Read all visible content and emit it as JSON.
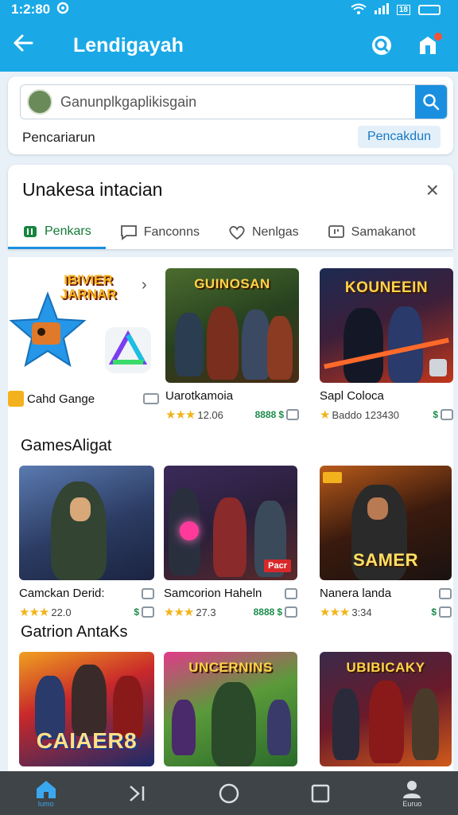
{
  "status_bar": {
    "time": "1:2:80",
    "battery": "18"
  },
  "app_bar": {
    "title": "Lendigayah",
    "back_icon": "arrow-left-icon",
    "search_icon": "search-icon",
    "notify_icon": "store-icon"
  },
  "search": {
    "value": "Ganunplkgaplikisgain",
    "label": "Pencariarun",
    "chip": "Pencakdun"
  },
  "tab_panel": {
    "heading": "Unakesa intacian",
    "tabs": [
      {
        "label": "Penkars",
        "icon": "controller-icon",
        "active": true
      },
      {
        "label": "Fanconns",
        "icon": "chat-icon",
        "active": false
      },
      {
        "label": "Nenlgas",
        "icon": "heart-icon",
        "active": false
      },
      {
        "label": "Samakanot",
        "icon": "message-icon",
        "active": false
      }
    ]
  },
  "row1": {
    "promo": {
      "logo_text": "IBIVIER JARNAR",
      "name": "Cahd Gange"
    },
    "tiles": [
      {
        "title": "GUINOSAN",
        "name": "Uarotkamoia",
        "rating": "12.06",
        "price": "8888"
      },
      {
        "title": "KOUNEEIN",
        "name": "Sapl Coloca",
        "rating": "Baddo 123430",
        "price": ""
      }
    ]
  },
  "section2": {
    "title": "GamesAligat",
    "tiles": [
      {
        "title": "",
        "name": "Camckan Derid:",
        "rating": "22.0",
        "price": ""
      },
      {
        "title": "",
        "name": "Samcorion Haheln",
        "rating": "27.3",
        "price": "8888",
        "badge": "Pacr"
      },
      {
        "title": "SAMER",
        "name": "Nanera landa",
        "rating": "3:34",
        "price": ""
      }
    ]
  },
  "section3": {
    "title": "Gatrion AntaKs",
    "tiles": [
      {
        "title": "CAIAER8"
      },
      {
        "title": "UNCERNINS"
      },
      {
        "title": "UBIBICAKY"
      }
    ]
  },
  "bottom_nav": [
    {
      "label": "Iumo",
      "icon": "home-icon",
      "active": true
    },
    {
      "label": "",
      "icon": "skip-icon",
      "active": false
    },
    {
      "label": "",
      "icon": "circle-icon",
      "active": false
    },
    {
      "label": "",
      "icon": "square-icon",
      "active": false
    },
    {
      "label": "Euruo",
      "icon": "person-icon",
      "active": false
    }
  ]
}
